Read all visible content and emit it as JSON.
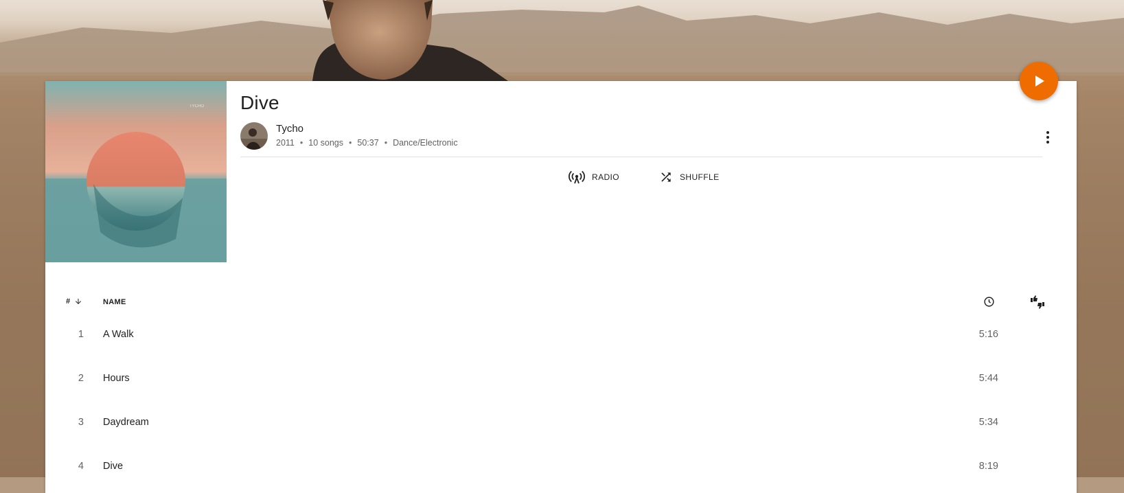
{
  "album": {
    "title": "Dive",
    "artist": "Tycho",
    "year": "2011",
    "song_count": "10 songs",
    "duration": "50:37",
    "genre": "Dance/Electronic"
  },
  "actions": {
    "radio_label": "RADIO",
    "shuffle_label": "SHUFFLE"
  },
  "table": {
    "col_number": "#",
    "col_name": "NAME"
  },
  "tracks": [
    {
      "number": "1",
      "title": "A Walk",
      "duration": "5:16"
    },
    {
      "number": "2",
      "title": "Hours",
      "duration": "5:44"
    },
    {
      "number": "3",
      "title": "Daydream",
      "duration": "5:34"
    },
    {
      "number": "4",
      "title": "Dive",
      "duration": "8:19"
    }
  ],
  "colors": {
    "accent": "#ef6c00"
  },
  "icons": {
    "play": "play-icon",
    "radio": "radio-icon",
    "shuffle": "shuffle-icon",
    "more": "more-vert-icon",
    "sort": "arrow-down-icon",
    "duration": "clock-icon",
    "rating": "thumbs-icon"
  }
}
